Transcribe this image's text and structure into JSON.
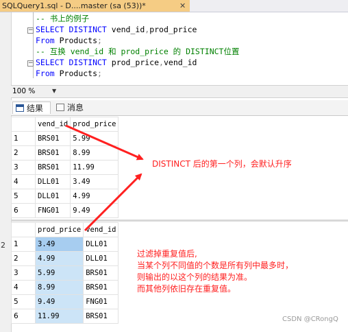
{
  "window": {
    "tab_title": "SQLQuery1.sql - D....master (sa (53))*",
    "close_glyph": "✕"
  },
  "editor": {
    "lines": [
      {
        "parts": [
          {
            "t": "-- 书上的例子",
            "c": "c-comment"
          }
        ]
      },
      {
        "parts": [
          {
            "t": "SELECT DISTINCT ",
            "c": "c-kw"
          },
          {
            "t": "vend_id",
            "c": "c-id"
          },
          {
            "t": ",",
            "c": "c-gray"
          },
          {
            "t": "prod_price",
            "c": "c-id"
          }
        ]
      },
      {
        "parts": [
          {
            "t": "From ",
            "c": "c-kw"
          },
          {
            "t": "Products",
            "c": "c-id"
          },
          {
            "t": ";",
            "c": "c-gray"
          }
        ]
      },
      {
        "parts": [
          {
            "t": "-- 互换 vend_id 和 prod_price 的 DISTINCT位置",
            "c": "c-comment"
          }
        ]
      },
      {
        "parts": [
          {
            "t": "SELECT DISTINCT ",
            "c": "c-kw"
          },
          {
            "t": "prod_price",
            "c": "c-id"
          },
          {
            "t": ",",
            "c": "c-gray"
          },
          {
            "t": "vend_id",
            "c": "c-id"
          }
        ]
      },
      {
        "parts": [
          {
            "t": "From ",
            "c": "c-kw"
          },
          {
            "t": "Products",
            "c": "c-id"
          },
          {
            "t": ";",
            "c": "c-gray"
          }
        ]
      }
    ]
  },
  "zoom": {
    "value": "100 %"
  },
  "results_tabs": {
    "results_label": "结果",
    "messages_label": "消息"
  },
  "grid1": {
    "headers": [
      "vend_id",
      "prod_price"
    ],
    "rows": [
      {
        "n": "1",
        "a": "BRS01",
        "b": "5.99"
      },
      {
        "n": "2",
        "a": "BRS01",
        "b": "8.99"
      },
      {
        "n": "3",
        "a": "BRS01",
        "b": "11.99"
      },
      {
        "n": "4",
        "a": "DLL01",
        "b": "3.49"
      },
      {
        "n": "5",
        "a": "DLL01",
        "b": "4.99"
      },
      {
        "n": "6",
        "a": "FNG01",
        "b": "9.49"
      }
    ]
  },
  "grid2": {
    "headers": [
      "prod_price",
      "vend_id"
    ],
    "rows": [
      {
        "n": "1",
        "a": "3.49",
        "b": "DLL01"
      },
      {
        "n": "2",
        "a": "4.99",
        "b": "DLL01"
      },
      {
        "n": "3",
        "a": "5.99",
        "b": "BRS01"
      },
      {
        "n": "4",
        "a": "8.99",
        "b": "BRS01"
      },
      {
        "n": "5",
        "a": "9.49",
        "b": "FNG01"
      },
      {
        "n": "6",
        "a": "11.99",
        "b": "BRS01"
      }
    ]
  },
  "annotations": {
    "note1": "DISTINCT 后的第一个列，会默认升序",
    "note2_lines": [
      "过滤掉重复值后,",
      "当某个列不同值的个数是所有列中最多时，",
      "则输出的以这个列的结果为准。",
      "而其他列依旧存在重复值。"
    ]
  },
  "left_number": "2",
  "watermark": "CSDN @CRongQ",
  "colors": {
    "annotation": "#ff2020",
    "tab_active": "#f5cc84",
    "selection": "#cce4f7"
  }
}
